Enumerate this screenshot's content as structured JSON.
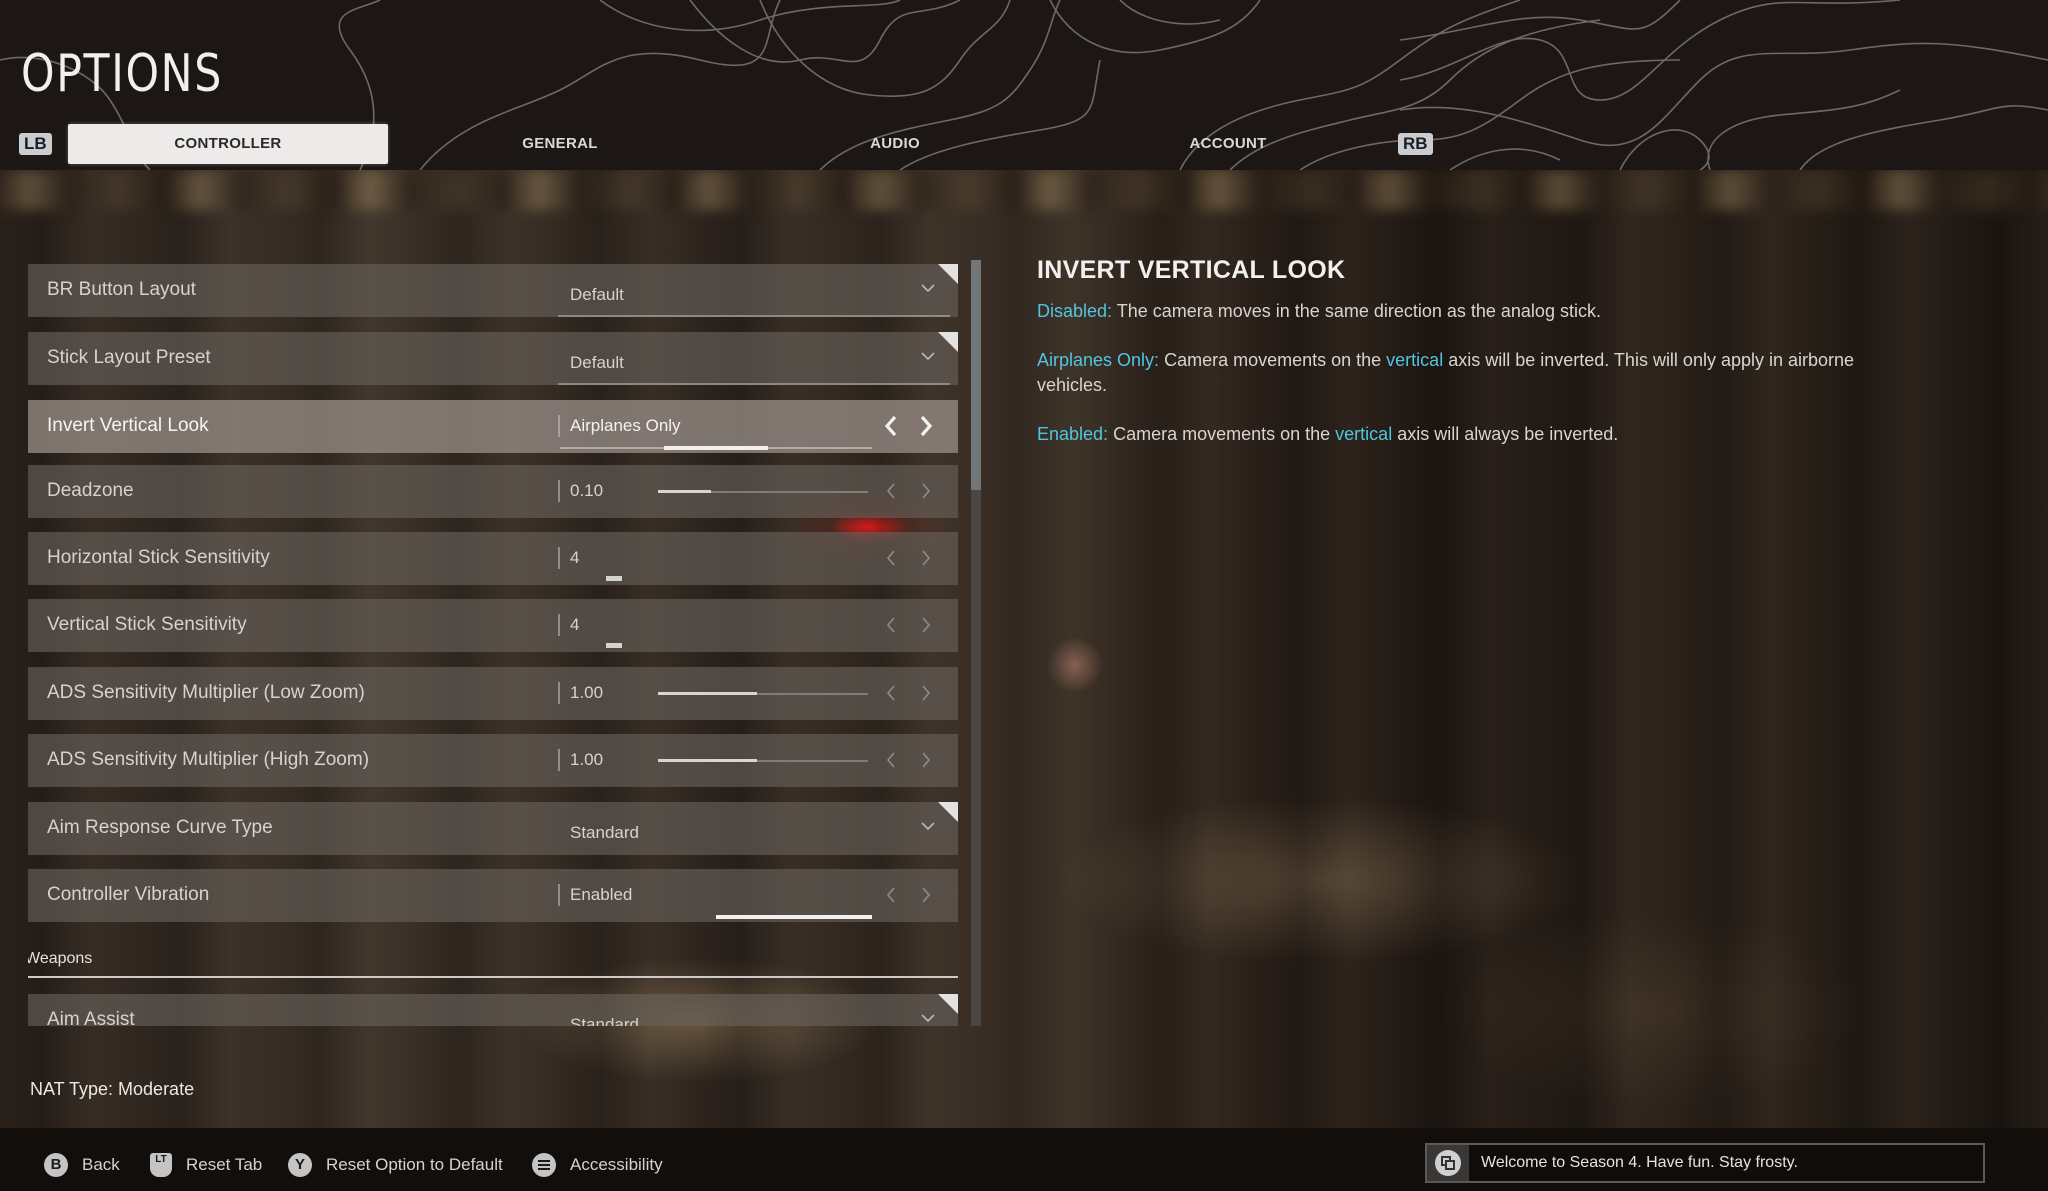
{
  "header": {
    "title": "OPTIONS",
    "left_bumper": "LB",
    "right_bumper": "RB",
    "tabs": [
      {
        "label": "CONTROLLER",
        "active": true
      },
      {
        "label": "GENERAL",
        "active": false
      },
      {
        "label": "AUDIO",
        "active": false
      },
      {
        "label": "ACCOUNT",
        "active": false
      }
    ]
  },
  "settings": {
    "rows": [
      {
        "label": "BR Button Layout",
        "type": "dropdown",
        "value": "Default"
      },
      {
        "label": "Stick Layout Preset",
        "type": "dropdown",
        "value": "Default"
      },
      {
        "label": "Invert Vertical Look",
        "type": "options",
        "value": "Airplanes Only",
        "selected": true,
        "option_index": 2,
        "option_count": 3
      },
      {
        "label": "Deadzone",
        "type": "slider",
        "value": "0.10",
        "fill_fraction": 0.25
      },
      {
        "label": "Horizontal Stick Sensitivity",
        "type": "stepper",
        "value": "4"
      },
      {
        "label": "Vertical Stick Sensitivity",
        "type": "stepper",
        "value": "4"
      },
      {
        "label": "ADS Sensitivity Multiplier (Low Zoom)",
        "type": "slider",
        "value": "1.00",
        "fill_fraction": 0.47
      },
      {
        "label": "ADS Sensitivity Multiplier (High Zoom)",
        "type": "slider",
        "value": "1.00",
        "fill_fraction": 0.47
      },
      {
        "label": "Aim Response Curve Type",
        "type": "dropdown",
        "value": "Standard"
      },
      {
        "label": "Controller Vibration",
        "type": "options",
        "value": "Enabled",
        "option_index": 2,
        "option_count": 2
      }
    ],
    "section": "Weapons",
    "section_rows": [
      {
        "label": "Aim Assist",
        "type": "dropdown",
        "value": "Standard"
      }
    ],
    "scroll_fraction_visible": 0.3
  },
  "description": {
    "title": "INVERT VERTICAL LOOK",
    "entries": [
      {
        "key": "Disabled:",
        "text": " The camera moves in the same direction as the analog stick."
      },
      {
        "key": "Airplanes Only:",
        "text_a": " Camera movements on the ",
        "kw": "vertical",
        "text_b": " axis will be inverted. This will only apply in airborne vehicles."
      },
      {
        "key": "Enabled:",
        "text_a": " Camera movements on the ",
        "kw": "vertical",
        "text_b": " axis will always be inverted."
      }
    ],
    "accent_color": "#4fc6e0"
  },
  "footer": {
    "nat_type": "NAT Type: Moderate",
    "prompts": [
      {
        "icon": "B",
        "label": "Back"
      },
      {
        "icon": "LT",
        "label": "Reset Tab"
      },
      {
        "icon": "Y",
        "label": "Reset Option to Default"
      },
      {
        "icon": "menu",
        "label": "Accessibility"
      }
    ],
    "notification": "Welcome to Season 4. Have fun. Stay frosty."
  }
}
